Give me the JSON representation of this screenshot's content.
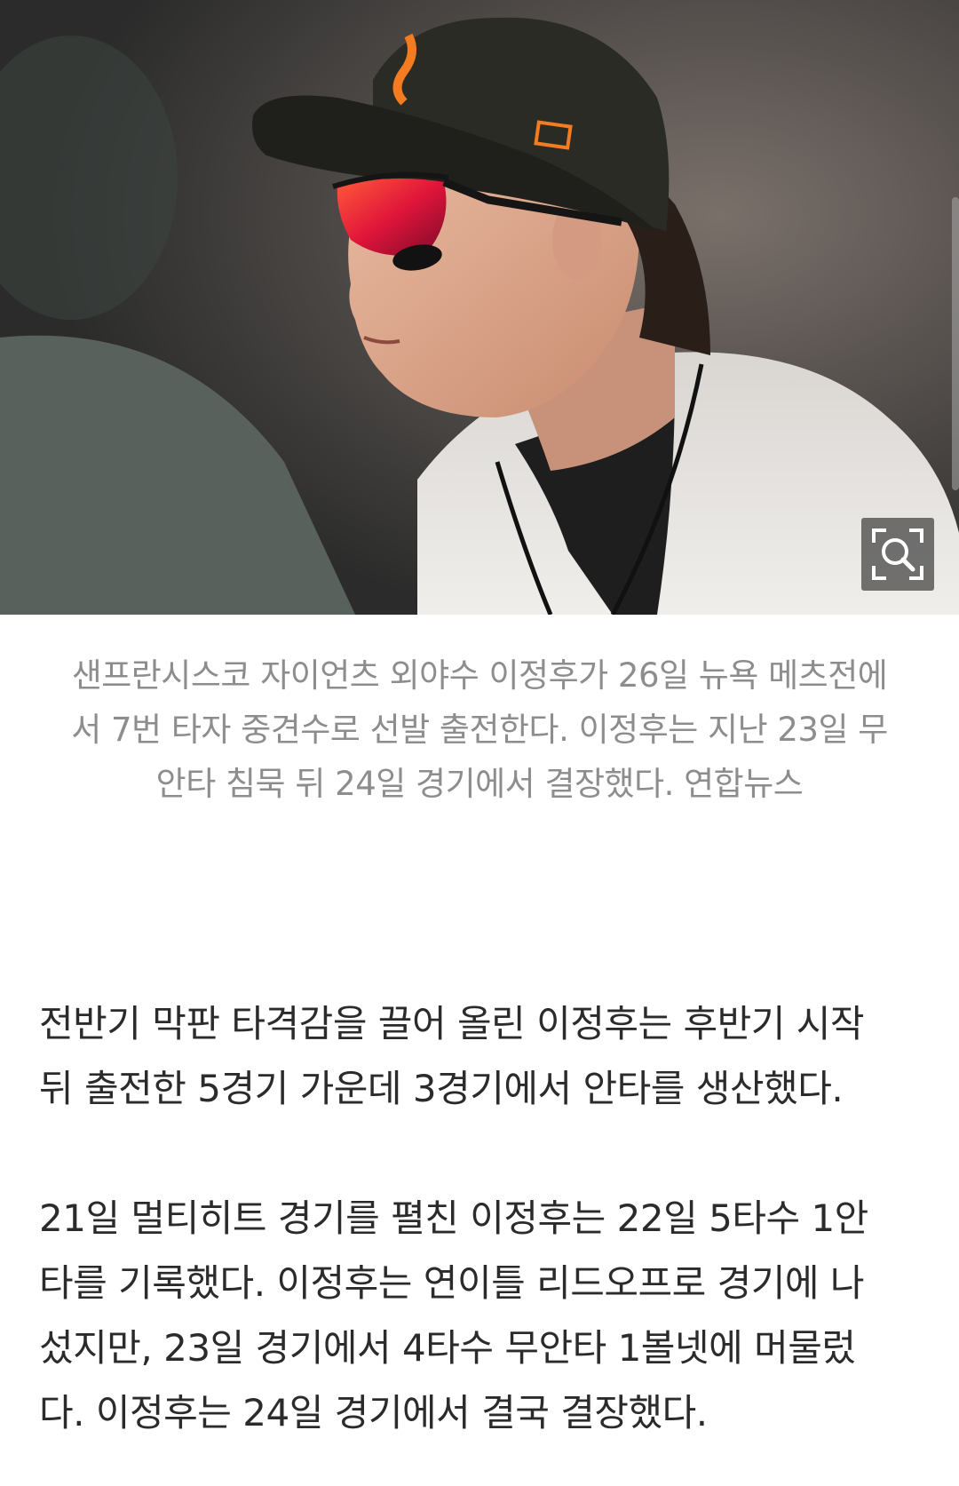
{
  "photo": {
    "alt": "이정후"
  },
  "zoom_button": {
    "icon": "zoom-magnifier-icon"
  },
  "caption": {
    "lines": [
      "샌프란시스코 자이언츠 외야수 이정후가 26일 뉴욕 메츠전에",
      "서 7번 타자 중견수로 선발 출전한다. 이정후는 지난 23일 무",
      "안타 침묵 뒤 24일 경기에서 결장했다. 연합뉴스"
    ]
  },
  "article": {
    "paragraphs": [
      {
        "lines": [
          "전반기 막판 타격감을 끌어 올린 이정후는 후반기 시작",
          "뒤 출전한 5경기 가운데 3경기에서 안타를 생산했다."
        ]
      },
      {
        "lines": [
          "21일 멀티히트 경기를 펼친 이정후는 22일 5타수 1안",
          "타를 기록했다. 이정후는 연이틀 리드오프로 경기에 나",
          "섰지만, 23일 경기에서 4타수 무안타 1볼넷에 머물렀",
          "다. 이정후는 24일 경기에서 결국 결장했다."
        ]
      }
    ]
  },
  "colors": {
    "caption_text": "#8d8d8d",
    "body_text": "#2b2b2b",
    "cap_orange": "#f47b20"
  }
}
